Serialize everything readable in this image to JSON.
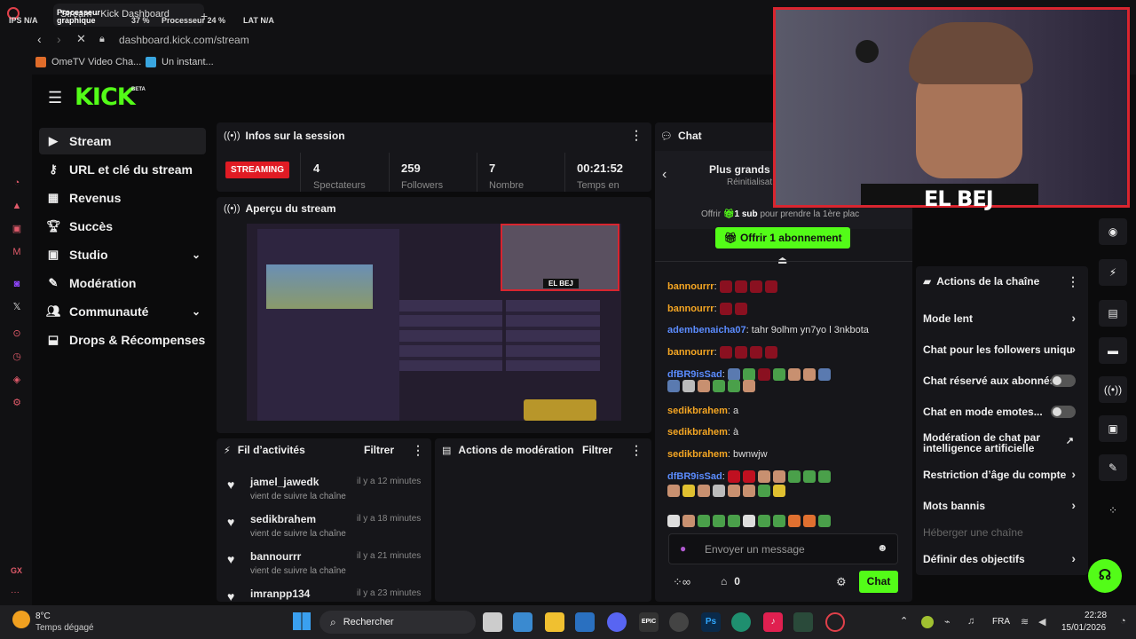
{
  "browser": {
    "tab_title": "Stream - Kick Dashboard",
    "perf_labels": {
      "ips": "IPS",
      "ips_val": "N/A",
      "gpu": "Processeur graphique",
      "gpu_val": "37 %",
      "cpu": "Processeur",
      "cpu_val": "24 %",
      "lat": "LAT",
      "lat_val": "N/A"
    },
    "url": "dashboard.kick.com/stream",
    "bookmarks": [
      "OmeTV Video Cha...",
      "Un instant..."
    ]
  },
  "logo": {
    "text": "KICK",
    "beta": "BETA"
  },
  "sidebar": {
    "items": [
      {
        "label": "Stream",
        "icon": "video-icon"
      },
      {
        "label": "URL et clé du stream",
        "icon": "link-icon"
      },
      {
        "label": "Revenus",
        "icon": "chart-icon"
      },
      {
        "label": "Succès",
        "icon": "trophy-icon"
      },
      {
        "label": "Studio",
        "icon": "grid-icon"
      },
      {
        "label": "Modération",
        "icon": "wrench-icon"
      },
      {
        "label": "Communauté",
        "icon": "people-icon"
      },
      {
        "label": "Drops & Récompenses",
        "icon": "gift-icon"
      }
    ]
  },
  "session": {
    "title": "Infos sur la session",
    "badge": "STREAMING",
    "stats": [
      {
        "value": "4",
        "label": "Spectateurs"
      },
      {
        "value": "259",
        "label": "Followers"
      },
      {
        "value": "7",
        "label": "Nombre"
      },
      {
        "value": "00:21:52",
        "label": "Temps en"
      }
    ]
  },
  "preview": {
    "title": "Aperçu du stream",
    "cam_name": "EL BEJ"
  },
  "activity": {
    "title": "Fil d’activités",
    "filter": "Filtrer",
    "items": [
      {
        "user": "jamel_jawedk",
        "time": "il y a 12 minutes",
        "desc": "vient de suivre la chaîne"
      },
      {
        "user": "sedikbrahem",
        "time": "il y a 18 minutes",
        "desc": "vient de suivre la chaîne"
      },
      {
        "user": "bannourrr",
        "time": "il y a 21 minutes",
        "desc": "vient de suivre la chaîne"
      },
      {
        "user": "imranpp134",
        "time": "il y a 23 minutes",
        "desc": ""
      }
    ]
  },
  "modactions": {
    "title": "Actions de modération",
    "filter": "Filtrer"
  },
  "chat": {
    "title": "Chat",
    "leaderboard_title": "Plus grands c",
    "leaderboard_sub": "Réinitialisat",
    "offer_text_pre": "Offrir",
    "offer_count": "1 sub",
    "offer_text_post": "pour prendre la 1ère plac",
    "offer_button": "Offrir 1 abonnement",
    "messages": [
      {
        "user": "bannourrr",
        "color": "#f5a623",
        "text": ""
      },
      {
        "user": "bannourrr",
        "color": "#f5a623",
        "text": ""
      },
      {
        "user": "adembenaicha07",
        "color": "#5b8cff",
        "text": "tahr 9olhm yn7yo l 3nkbota"
      },
      {
        "user": "bannourrr",
        "color": "#f5a623",
        "text": ""
      },
      {
        "user": "dfBR9isSad",
        "color": "#5b8cff",
        "text": ""
      },
      {
        "user": "sedikbrahem",
        "color": "#f5a623",
        "text": "a"
      },
      {
        "user": "sedikbrahem",
        "color": "#f5a623",
        "text": "à"
      },
      {
        "user": "sedikbrahem",
        "color": "#f5a623",
        "text": "bwnwjw"
      },
      {
        "user": "dfBR9isSad",
        "color": "#5b8cff",
        "text": ""
      }
    ],
    "input_placeholder": "Envoyer un message",
    "points_value": "0",
    "send_button": "Chat"
  },
  "webcam": {
    "name": "EL BEJ"
  },
  "channel_actions": {
    "title": "Actions de la chaîne",
    "rows": [
      {
        "label": "Mode lent",
        "control": "chevron"
      },
      {
        "label": "Chat pour les followers uniqu",
        "control": "chevron"
      },
      {
        "label": "Chat réservé aux abonnés",
        "control": "toggle"
      },
      {
        "label": "Chat en mode emotes...",
        "control": "toggle"
      },
      {
        "label": "Modération de chat par intelligence artificielle",
        "control": "external"
      },
      {
        "label": "Restriction d’âge du compte",
        "control": "chevron"
      },
      {
        "label": "Mots bannis",
        "control": "chevron"
      },
      {
        "label": "Héberger une chaîne",
        "control": "none"
      },
      {
        "label": "Définir des objectifs",
        "control": "chevron"
      }
    ]
  },
  "taskbar": {
    "weather_temp": "8°C",
    "weather_desc": "Temps dégagé",
    "search": "Rechercher",
    "lang": "FRA",
    "time": "22:28",
    "date": "15/01/2026"
  },
  "colors": {
    "kick_green": "#53fc18",
    "streaming_red": "#e01b24",
    "webcam_border": "#d9252f"
  }
}
